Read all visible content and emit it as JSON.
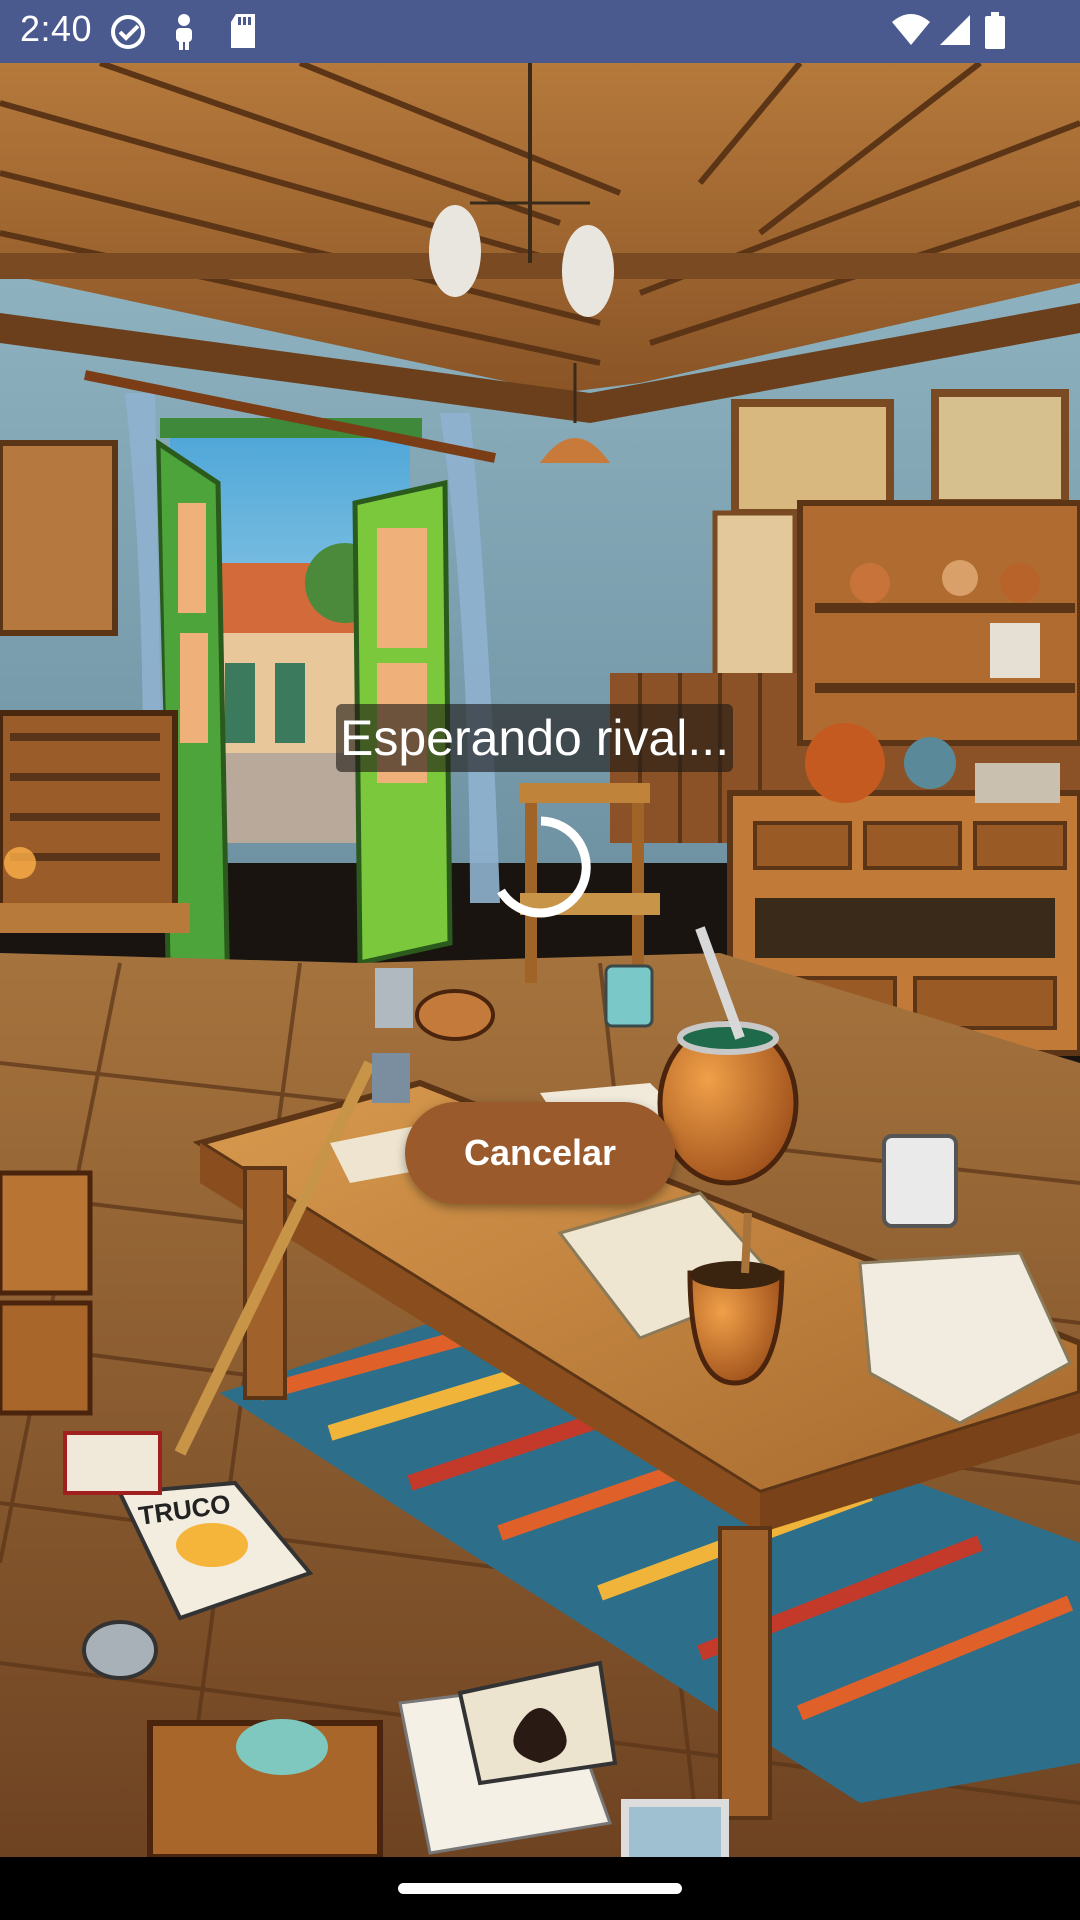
{
  "status_bar": {
    "time": "2:40",
    "left_icons": [
      "check-circle-icon",
      "person-pin-icon",
      "sd-card-icon"
    ],
    "right_icons": [
      "wifi-icon",
      "signal-icon",
      "battery-icon"
    ],
    "background": "#4a5a8f"
  },
  "matchmaking": {
    "status_text": "Esperando rival...",
    "cancel_label": "Cancelar",
    "button_color": "#9a5a2b"
  },
  "background": {
    "scene": "illustrated-rustic-room",
    "sign_text": "TRUCO"
  }
}
